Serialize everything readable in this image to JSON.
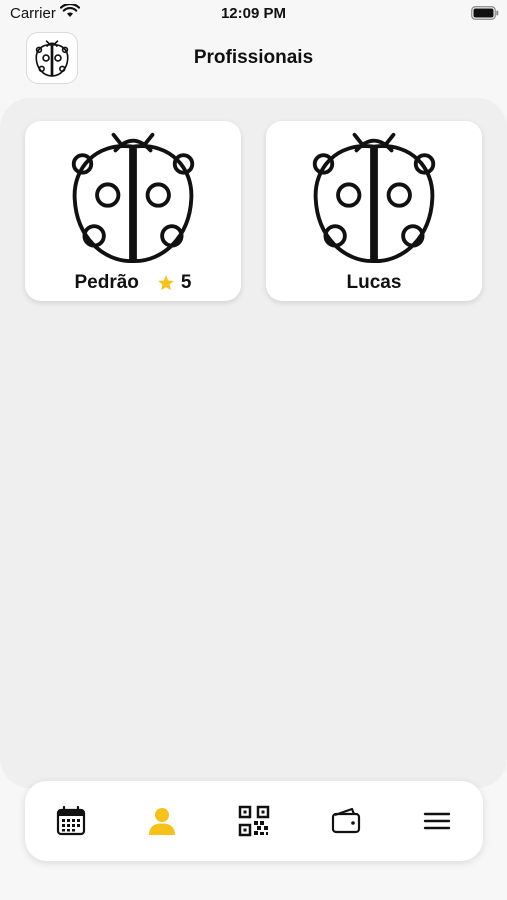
{
  "status_bar": {
    "carrier": "Carrier",
    "time": "12:09 PM"
  },
  "header": {
    "title": "Profissionais",
    "logo_icon": "ladybug-icon"
  },
  "professionals": [
    {
      "name": "Pedrão",
      "rating": "5",
      "avatar_icon": "ladybug-icon",
      "has_rating": true
    },
    {
      "name": "Lucas",
      "avatar_icon": "ladybug-icon",
      "has_rating": false
    }
  ],
  "tab_bar": {
    "tabs": [
      {
        "icon": "calendar-icon",
        "active": false
      },
      {
        "icon": "user-icon",
        "active": true
      },
      {
        "icon": "qr-code-icon",
        "active": false
      },
      {
        "icon": "wallet-icon",
        "active": false
      },
      {
        "icon": "menu-icon",
        "active": false
      }
    ]
  },
  "colors": {
    "accent": "#f6c21a",
    "star": "#f6c21a",
    "icon": "#111111"
  }
}
